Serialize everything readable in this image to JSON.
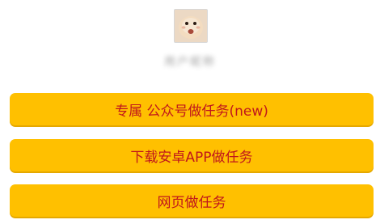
{
  "profile": {
    "avatar_icon": "avatar-photo",
    "name_blurred": "用户昵称"
  },
  "buttons": [
    {
      "label": "专属 公众号做任务(new)"
    },
    {
      "label": "下载安卓APP做任务"
    },
    {
      "label": "网页做任务"
    }
  ],
  "colors": {
    "button_bg": "#ffc000",
    "button_text": "#c0161c"
  }
}
